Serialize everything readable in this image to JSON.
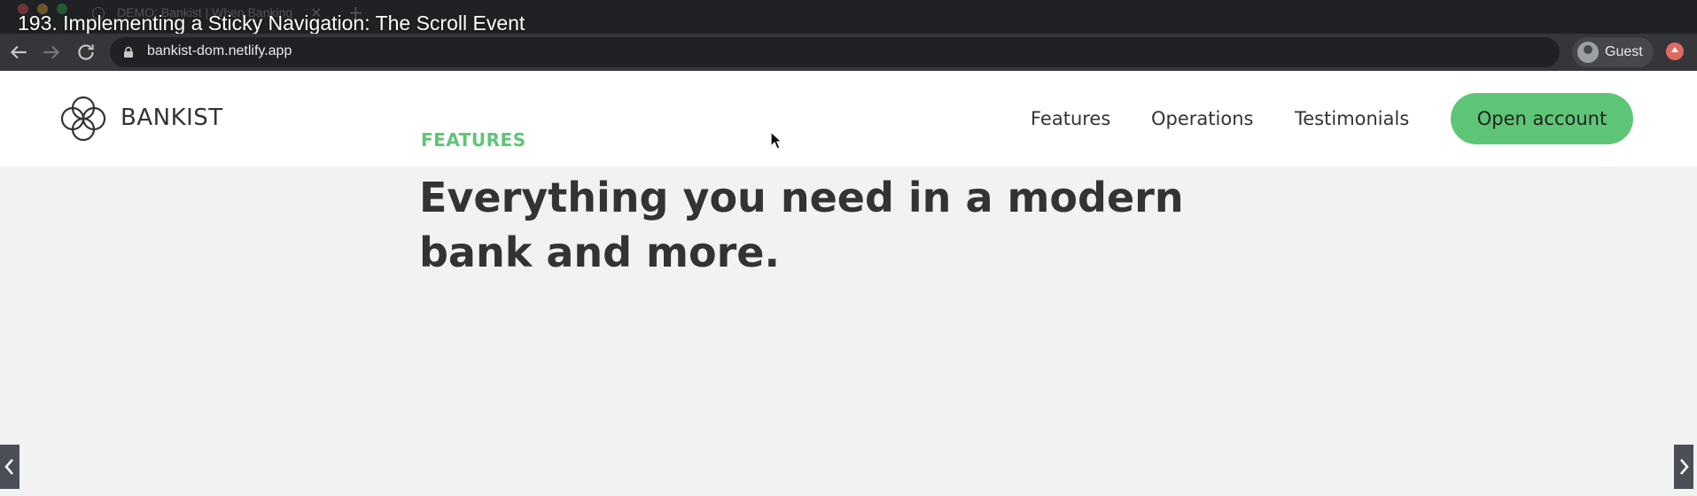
{
  "browser": {
    "tab_title": "DEMO: Bankist | When Banking",
    "url": "bankist-dom.netlify.app",
    "profile_name": "Guest"
  },
  "video": {
    "title": "193. Implementing a Sticky Navigation: The Scroll Event"
  },
  "header": {
    "logo_text": "BANKIST",
    "nav": {
      "features": "Features",
      "operations": "Operations",
      "testimonials": "Testimonials"
    },
    "cta_label": "Open account"
  },
  "section": {
    "label": "FEATURES",
    "heading": "Everything you need in a modern bank and more."
  },
  "colors": {
    "brand_green": "#5ec576",
    "text_dark": "#333333",
    "page_background": "#f2f2f2"
  },
  "icons": [
    "back-arrow-icon",
    "forward-arrow-icon",
    "reload-icon",
    "lock-icon",
    "guest-avatar-icon",
    "update-icon",
    "chevron-left-icon",
    "chevron-right-icon",
    "bankist-logo-icon",
    "mouse-cursor-icon"
  ]
}
